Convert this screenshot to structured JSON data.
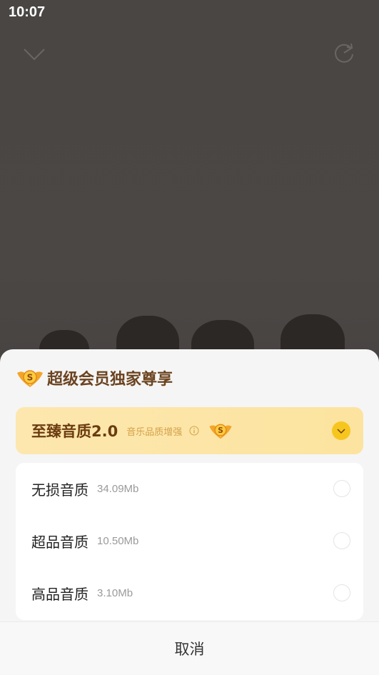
{
  "status_bar": {
    "time": "10:07"
  },
  "header": {
    "collapse_icon": "chevron-down-icon",
    "share_icon": "share-icon"
  },
  "sheet": {
    "title": "超级会员独家尊享",
    "premium_option": {
      "label": "至臻音质2.0",
      "subtitle": "音乐品质增强",
      "selected": true
    },
    "options": [
      {
        "label": "无损音质",
        "size": "34.09Mb",
        "selected": false
      },
      {
        "label": "超品音质",
        "size": "10.50Mb",
        "selected": false
      },
      {
        "label": "高品音质",
        "size": "3.10Mb",
        "selected": false
      }
    ],
    "cancel_label": "取消"
  },
  "colors": {
    "sheet_bg": "#f5f5f5",
    "premium_bg": "#fde7ae",
    "premium_text": "#6b3c10",
    "accent_yellow": "#f6c61e",
    "title_brown": "#6b4320"
  }
}
